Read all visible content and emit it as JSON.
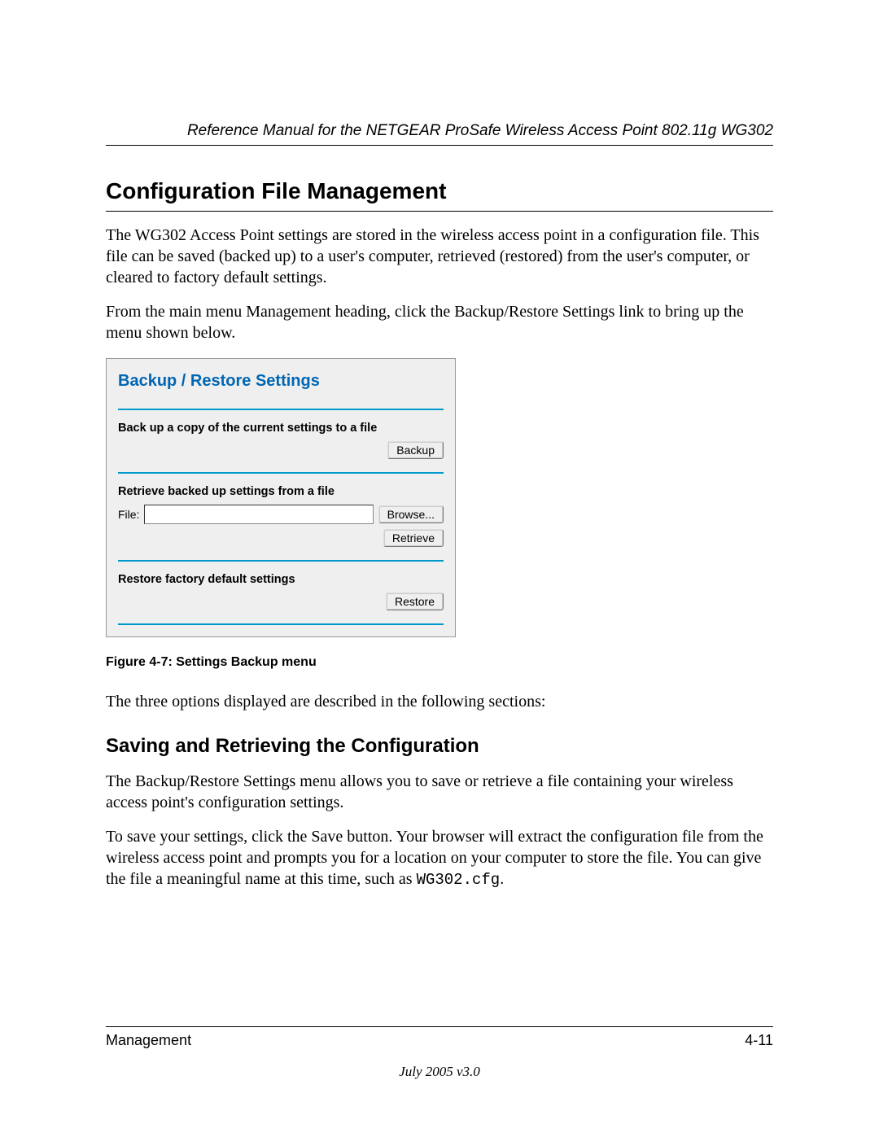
{
  "header": {
    "manual_title": "Reference Manual for the NETGEAR ProSafe Wireless Access Point 802.11g WG302"
  },
  "section1": {
    "title": "Configuration File Management",
    "p1": "The WG302 Access Point settings are stored in the wireless access point in a configuration file. This file can be saved (backed up) to a user's computer, retrieved (restored) from the user's computer, or cleared to factory default settings.",
    "p2": "From the main menu Management heading, click the Backup/Restore Settings link to bring up the menu shown below."
  },
  "screenshot": {
    "title": "Backup / Restore Settings",
    "backup_label": "Back up a copy of the current settings to a file",
    "backup_btn": "Backup",
    "retrieve_label": "Retrieve backed up settings from a file",
    "file_lbl": "File:",
    "file_value": "",
    "browse_btn": "Browse...",
    "retrieve_btn": "Retrieve",
    "restore_label": "Restore factory default settings",
    "restore_btn": "Restore"
  },
  "figure_caption": "Figure 4-7:  Settings Backup menu",
  "after_fig_p": "The three options displayed are described in the following sections:",
  "section2": {
    "title": "Saving and Retrieving the Configuration",
    "p1": "The Backup/Restore Settings menu allows you to save or retrieve a file containing your wireless access point's configuration settings.",
    "p2_a": "To save your settings, click the Save button. Your browser will extract the configuration file from the wireless access point and prompts you for a location on your computer to store the file. You can give the file a meaningful name at this time, such as ",
    "p2_code": "WG302.cfg",
    "p2_b": "."
  },
  "footer": {
    "left": "Management",
    "right": "4-11",
    "date": "July 2005 v3.0"
  }
}
